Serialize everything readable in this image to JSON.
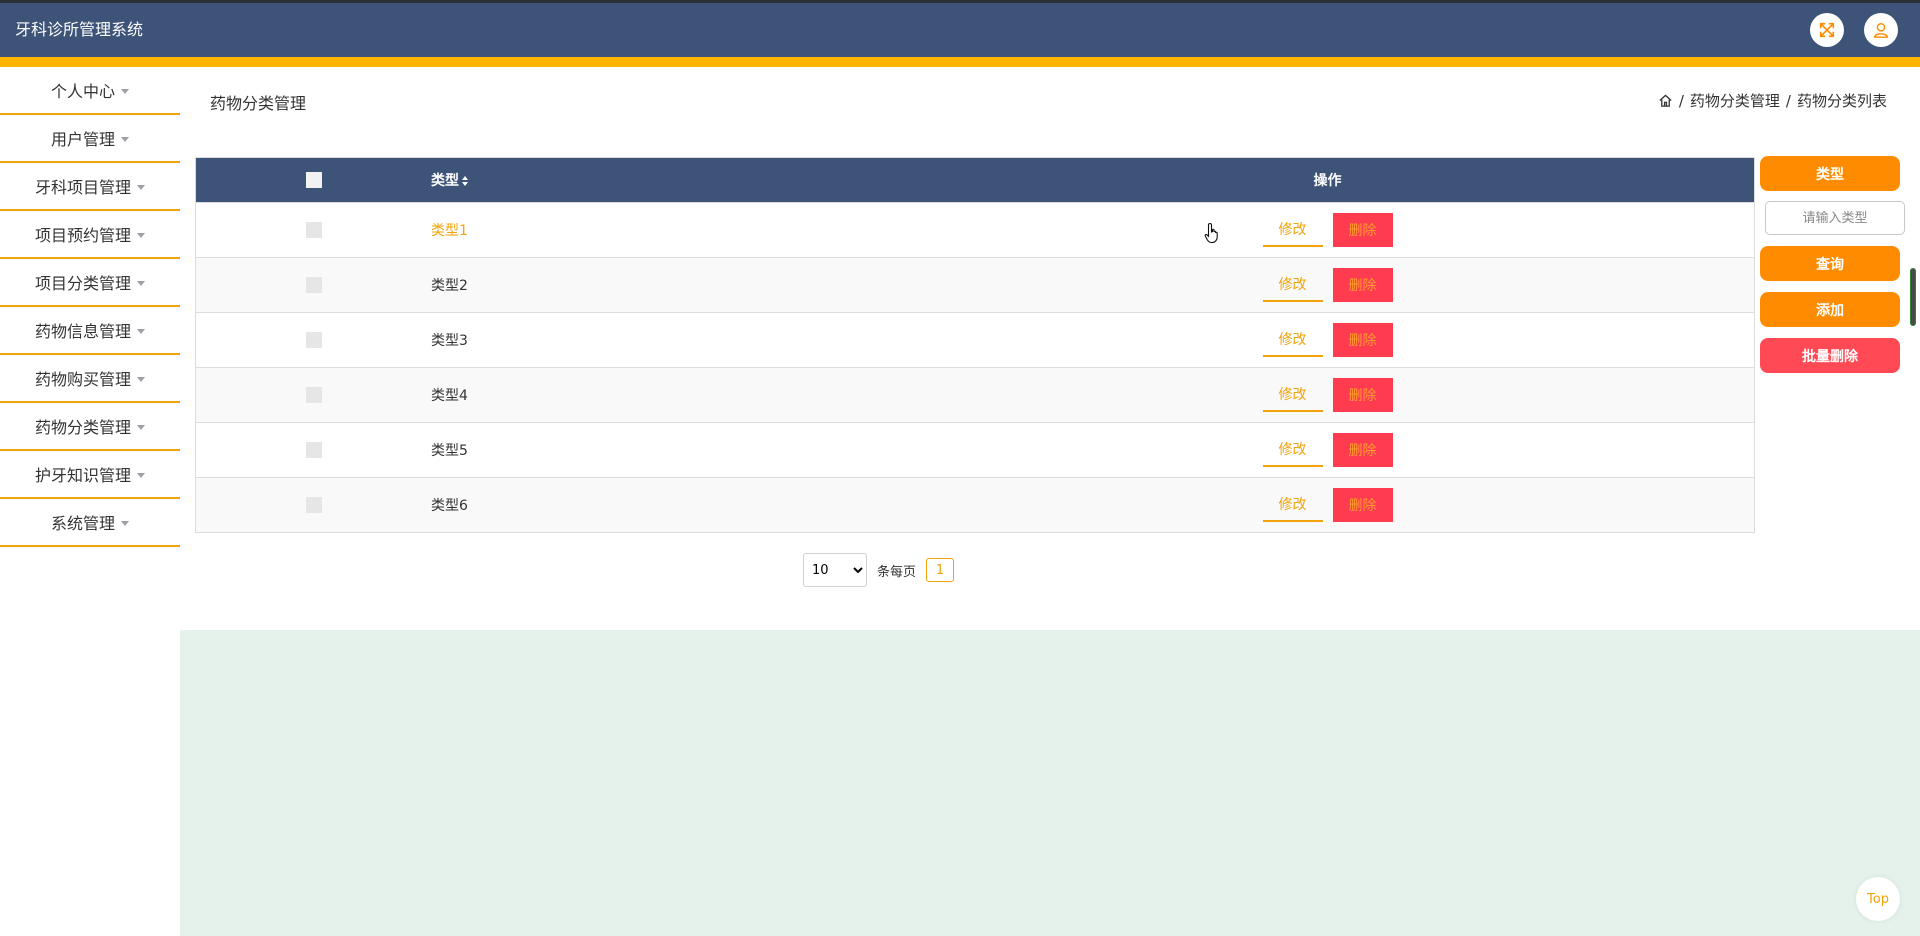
{
  "app": {
    "title": "牙科诊所管理系统"
  },
  "header": {
    "fullscreen_icon": "fullscreen-icon",
    "user_icon": "user-icon"
  },
  "sidebar": {
    "items": [
      {
        "label": "个人中心"
      },
      {
        "label": "用户管理"
      },
      {
        "label": "牙科项目管理"
      },
      {
        "label": "项目预约管理"
      },
      {
        "label": "项目分类管理"
      },
      {
        "label": "药物信息管理"
      },
      {
        "label": "药物购买管理"
      },
      {
        "label": "药物分类管理"
      },
      {
        "label": "护牙知识管理"
      },
      {
        "label": "系统管理"
      }
    ]
  },
  "page": {
    "title": "药物分类管理",
    "breadcrumb": {
      "section": "药物分类管理",
      "current": "药物分类列表",
      "separator": "/"
    }
  },
  "table": {
    "headers": {
      "type": "类型",
      "ops": "操作"
    },
    "rows": [
      {
        "type": "类型1",
        "edit": "修改",
        "delete": "删除"
      },
      {
        "type": "类型2",
        "edit": "修改",
        "delete": "删除"
      },
      {
        "type": "类型3",
        "edit": "修改",
        "delete": "删除"
      },
      {
        "type": "类型4",
        "edit": "修改",
        "delete": "删除"
      },
      {
        "type": "类型5",
        "edit": "修改",
        "delete": "删除"
      },
      {
        "type": "类型6",
        "edit": "修改",
        "delete": "删除"
      }
    ]
  },
  "pager": {
    "page_size": "10",
    "per_page_label": "条每页",
    "current_page": "1"
  },
  "filter": {
    "type_label": "类型",
    "type_placeholder": "请输入类型",
    "search": "查询",
    "add": "添加",
    "batch_delete": "批量删除"
  },
  "back_to_top": "Top",
  "colors": {
    "header": "#3e5378",
    "accent": "#ffb400",
    "orange": "#ff8c00",
    "red": "#ff4a55",
    "mint": "#e5f2ec"
  }
}
